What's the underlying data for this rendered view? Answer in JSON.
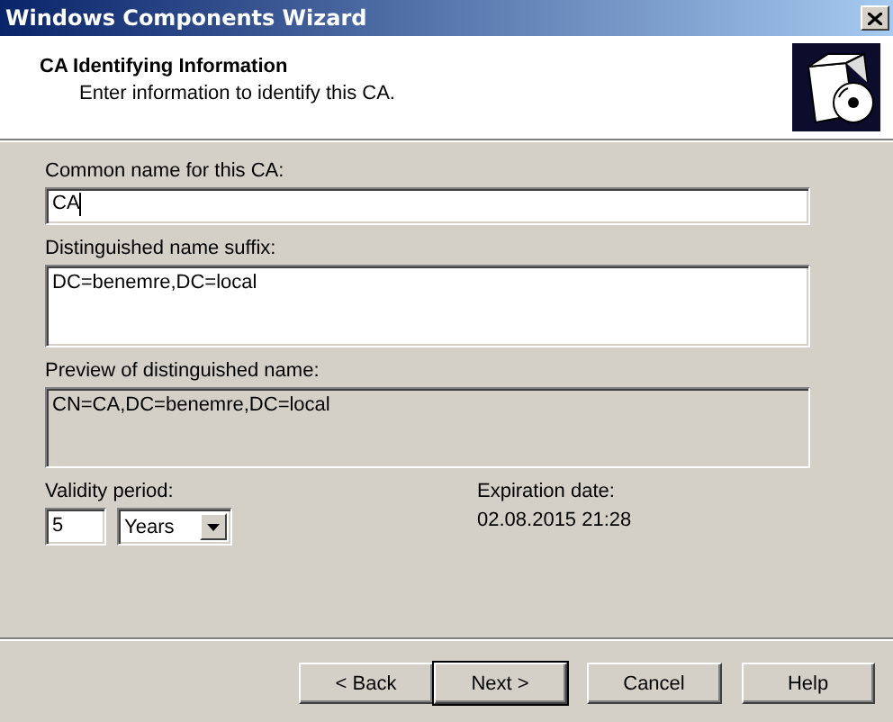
{
  "window": {
    "title": "Windows Components Wizard"
  },
  "header": {
    "title": "CA Identifying Information",
    "subtitle": "Enter information to identify this CA."
  },
  "fields": [
    {
      "kind": "text",
      "label": "Common name for this CA:",
      "value": "CA",
      "focused": true
    },
    {
      "kind": "multiline",
      "label": "Distinguished name suffix:",
      "value": "DC=benemre,DC=local",
      "focused": false
    },
    {
      "kind": "readonly",
      "label": "Preview of distinguished name:",
      "value": "CN=CA,DC=benemre,DC=local",
      "focused": false
    }
  ],
  "validity": {
    "label": "Validity period:",
    "value": "5",
    "unit": "Years"
  },
  "expiration": {
    "label": "Expiration date:",
    "value": "02.08.2015 21:28"
  },
  "buttons": [
    {
      "label": "< Back",
      "default": false
    },
    {
      "label": "Next >",
      "default": true
    },
    {
      "label": "Cancel",
      "default": false
    },
    {
      "label": "Help",
      "default": false
    }
  ]
}
